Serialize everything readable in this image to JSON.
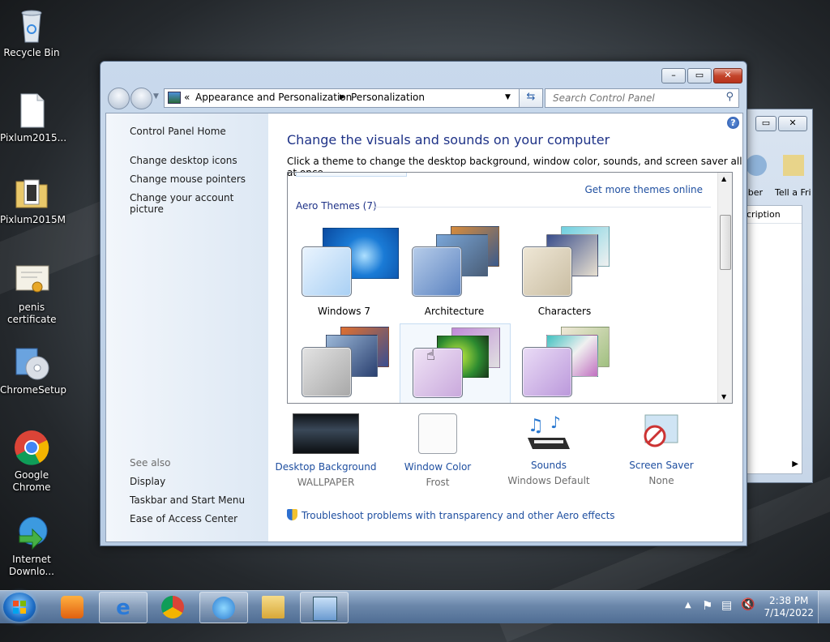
{
  "desktop": {
    "icons": [
      {
        "label": "Recycle Bin"
      },
      {
        "label": "Pixlum2015..."
      },
      {
        "label": "Pixlum2015M"
      },
      {
        "label": "penis certificate"
      },
      {
        "label": "ChromeSetup"
      },
      {
        "label": "Google Chrome"
      },
      {
        "label": "Internet Downlo..."
      }
    ]
  },
  "background_window": {
    "toolbar_items": [
      "ober",
      "Tell a Fri"
    ],
    "column_header": "cription"
  },
  "window": {
    "address": {
      "overflow": "«",
      "crumbs": [
        "Appearance and Personalization",
        "Personalization"
      ]
    },
    "search_placeholder": "Search Control Panel",
    "left_pane": {
      "home": "Control Panel Home",
      "links": [
        "Change desktop icons",
        "Change mouse pointers",
        "Change your account picture"
      ],
      "see_also_label": "See also",
      "see_also": [
        "Display",
        "Taskbar and Start Menu",
        "Ease of Access Center"
      ]
    },
    "title": "Change the visuals and sounds on your computer",
    "subtitle": "Click a theme to change the desktop background, window color, sounds, and screen saver all at once.",
    "get_more_themes": "Get more themes online",
    "group_label": "Aero Themes (7)",
    "themes": [
      {
        "name": "Windows 7"
      },
      {
        "name": "Architecture"
      },
      {
        "name": "Characters"
      },
      {
        "name": ""
      },
      {
        "name": ""
      },
      {
        "name": ""
      }
    ],
    "bottom": [
      {
        "title": "Desktop Background",
        "value": "WALLPAPER"
      },
      {
        "title": "Window Color",
        "value": "Frost"
      },
      {
        "title": "Sounds",
        "value": "Windows Default"
      },
      {
        "title": "Screen Saver",
        "value": "None"
      }
    ],
    "troubleshoot": "Troubleshoot problems with transparency and other Aero effects"
  },
  "taskbar": {
    "time": "2:38 PM",
    "date": "7/14/2022"
  },
  "colors": {
    "link": "#1f4fa0",
    "heading": "#1e3287",
    "taskbar": "#4f6d93"
  }
}
